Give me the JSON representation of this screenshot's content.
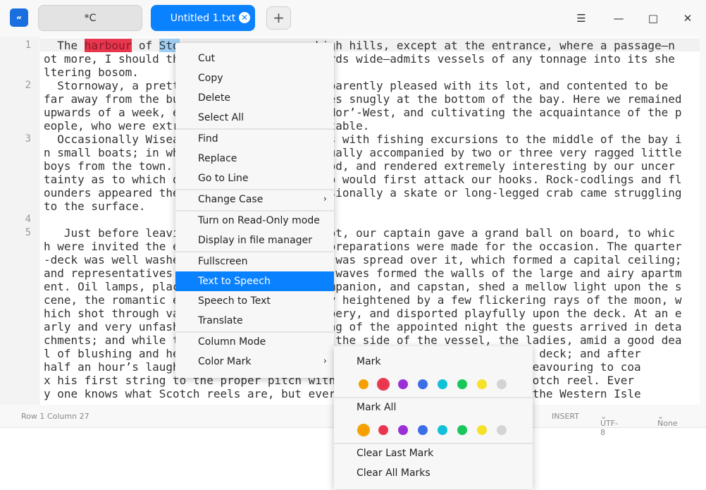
{
  "titlebar": {
    "logo_glyph": "“",
    "tabs": [
      {
        "label": "*C"
      },
      {
        "label": "Untitled 1.txt",
        "close_glyph": "✕"
      }
    ],
    "add_tab_glyph": "+",
    "menu_glyph": "☰",
    "minimize_glyph": "—",
    "maximize_glyph": "□",
    "close_glyph": "✕"
  },
  "editor": {
    "line_numbers": [
      "1",
      "2",
      "3",
      "4",
      "5"
    ],
    "line1_pre": "  The ",
    "line1_red": "harbour",
    "line1_mid": " of ",
    "line1_blue": "Sto",
    "line1_post": "                    high hills, except at the entrance, where a passage—n",
    "lines": [
      "ot more, I should th                    yards wide—admits vessels of any tonnage into its she",
      "ltering bosom.",
      "  Stornoway, a prett                    apparently pleased with its lot, and contented to be",
      "far away from the bu                    lies snugly at the bottom of the bay. Here we remained",
      "upwards of a week, e                    d Nor’-West, and cultivating the acquaintance of the p",
      "eople, who were extr                    pitable.",
      "  Occasionally Wisea                    ves with fishing excursions to the middle of the bay i",
      "n small boats; in wh                    usually accompanied by two or three very ragged little",
      "boys from the town.                     good, and rendered extremely interesting by our uncer",
      "tainty as to which o                    eep would first attack our hooks. Rock-codlings and fl",
      "ounders appeared the                    casionally a skate or long-legged crab came struggling",
      "to the surface.",
      "",
      "   Just before leavi                    spot, our captain gave a grand ball on board, to whic",
      "h were invited the e                    t preparations were made for the occasion. The quarter",
      "-deck was well washe                    ng was spread over it, which formed a capital ceiling;",
      "and representatives                     at waves formed the walls of the large and airy apartm",
      "ent. Oil lamps, plac                    companion, and capstan, shed a mellow light upon the s",
      "cene, the romantic e                    tly heightened by a few flickering rays of the moon, w",
      "hich shot through va                    rapery, and disported playfully upon the deck. At an e",
      "arly and very unfash                    ning of the appointed night the guests arrived in deta",
      "chments; and while t                    up the side of the vessel, the ladies, amid a good dea",
      "l of blushing and he                                           served on deck; and after",
      "half an hour’s laugh                                           r was endeavouring to coa",
      "x his first string to the proper pitch with                    with a Scotch reel. Ever",
      "y one knows what Scotch reels are, but ever                    elles of the Western Isle"
    ]
  },
  "status": {
    "row": "Row 1",
    "column": "Column 27",
    "mode": "INSERT",
    "encoding": "UTF-8",
    "highlight": "None"
  },
  "context_menu": {
    "items": [
      "Cut",
      "Copy",
      "Delete",
      "Select All",
      "Find",
      "Replace",
      "Go to Line",
      "Change Case",
      "Turn on Read-Only mode",
      "Display in file manager",
      "Fullscreen",
      "Text to Speech",
      "Speech to Text",
      "Translate",
      "Column Mode",
      "Color Mark"
    ],
    "selected": "Text to Speech",
    "submenu_arrow": "›"
  },
  "color_mark_menu": {
    "mark_label": "Mark",
    "mark_all_label": "Mark All",
    "clear_last_label": "Clear Last Mark",
    "clear_all_label": "Clear All Marks",
    "colors": [
      "#f5a000",
      "#e8364e",
      "#9a2fd6",
      "#3a6fe8",
      "#12c0d8",
      "#18c75a",
      "#f7e02a",
      "#d4d4d4"
    ],
    "mark_selected_color": "#e8364e",
    "mark_all_selected_color": "#f5a000"
  }
}
